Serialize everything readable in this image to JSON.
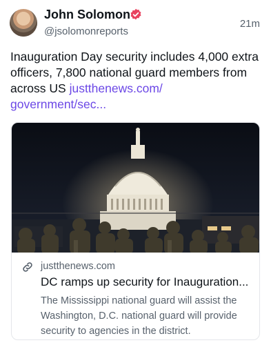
{
  "author": {
    "display_name": "John Solomon",
    "handle": "@jsolomonreports",
    "verified_badge_icon": "verified-badge-icon",
    "badge_color": "#e8425f"
  },
  "post": {
    "timestamp": "21m",
    "text": "Inauguration Day security includes 4,000 extra officers, 7,800 national guard members from across US ",
    "link_text": "justthenews.com/\ngovernment/sec..."
  },
  "link_card": {
    "domain": "justthenews.com",
    "title": "DC ramps up security for Inauguration...",
    "description": "The Mississippi national guard will assist the Washington, D.C. national guard will provide security to agencies in the district.",
    "icon": "link-icon",
    "image_alt_subject": "capitol-dome-at-night-with-guard-troops"
  },
  "colors": {
    "accent_link": "#6b47e6",
    "secondary_text": "#57616c",
    "primary_text": "#0f1419"
  }
}
